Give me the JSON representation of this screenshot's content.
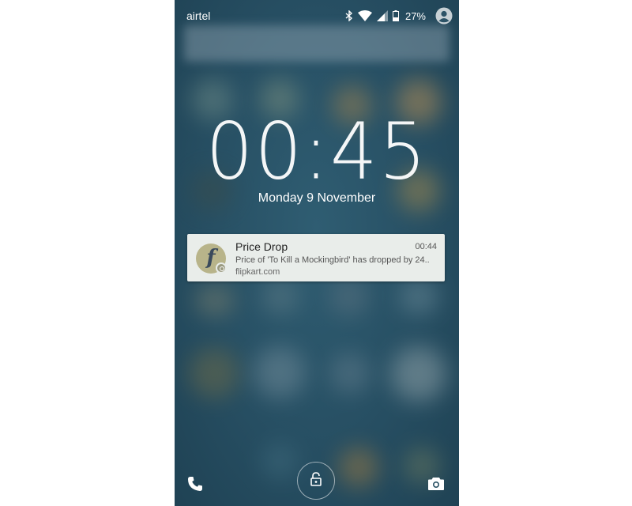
{
  "status_bar": {
    "carrier": "airtel",
    "battery_percent": "27%",
    "icons": [
      "bluetooth-icon",
      "wifi-icon",
      "cellular-signal-icon",
      "battery-icon",
      "user-avatar-icon"
    ]
  },
  "lockscreen": {
    "time": "00:45",
    "date": "Monday 9 November"
  },
  "notification": {
    "title": "Price Drop",
    "time": "00:44",
    "text": "Price of 'To Kill a Mockingbird' has dropped by 24..",
    "source": "flipkart.com",
    "app_icon_letter": "f",
    "app_icon": "flipkart-logo-icon"
  },
  "bottom_bar": {
    "left": "phone-icon",
    "center": "lock-icon",
    "right": "camera-icon"
  }
}
